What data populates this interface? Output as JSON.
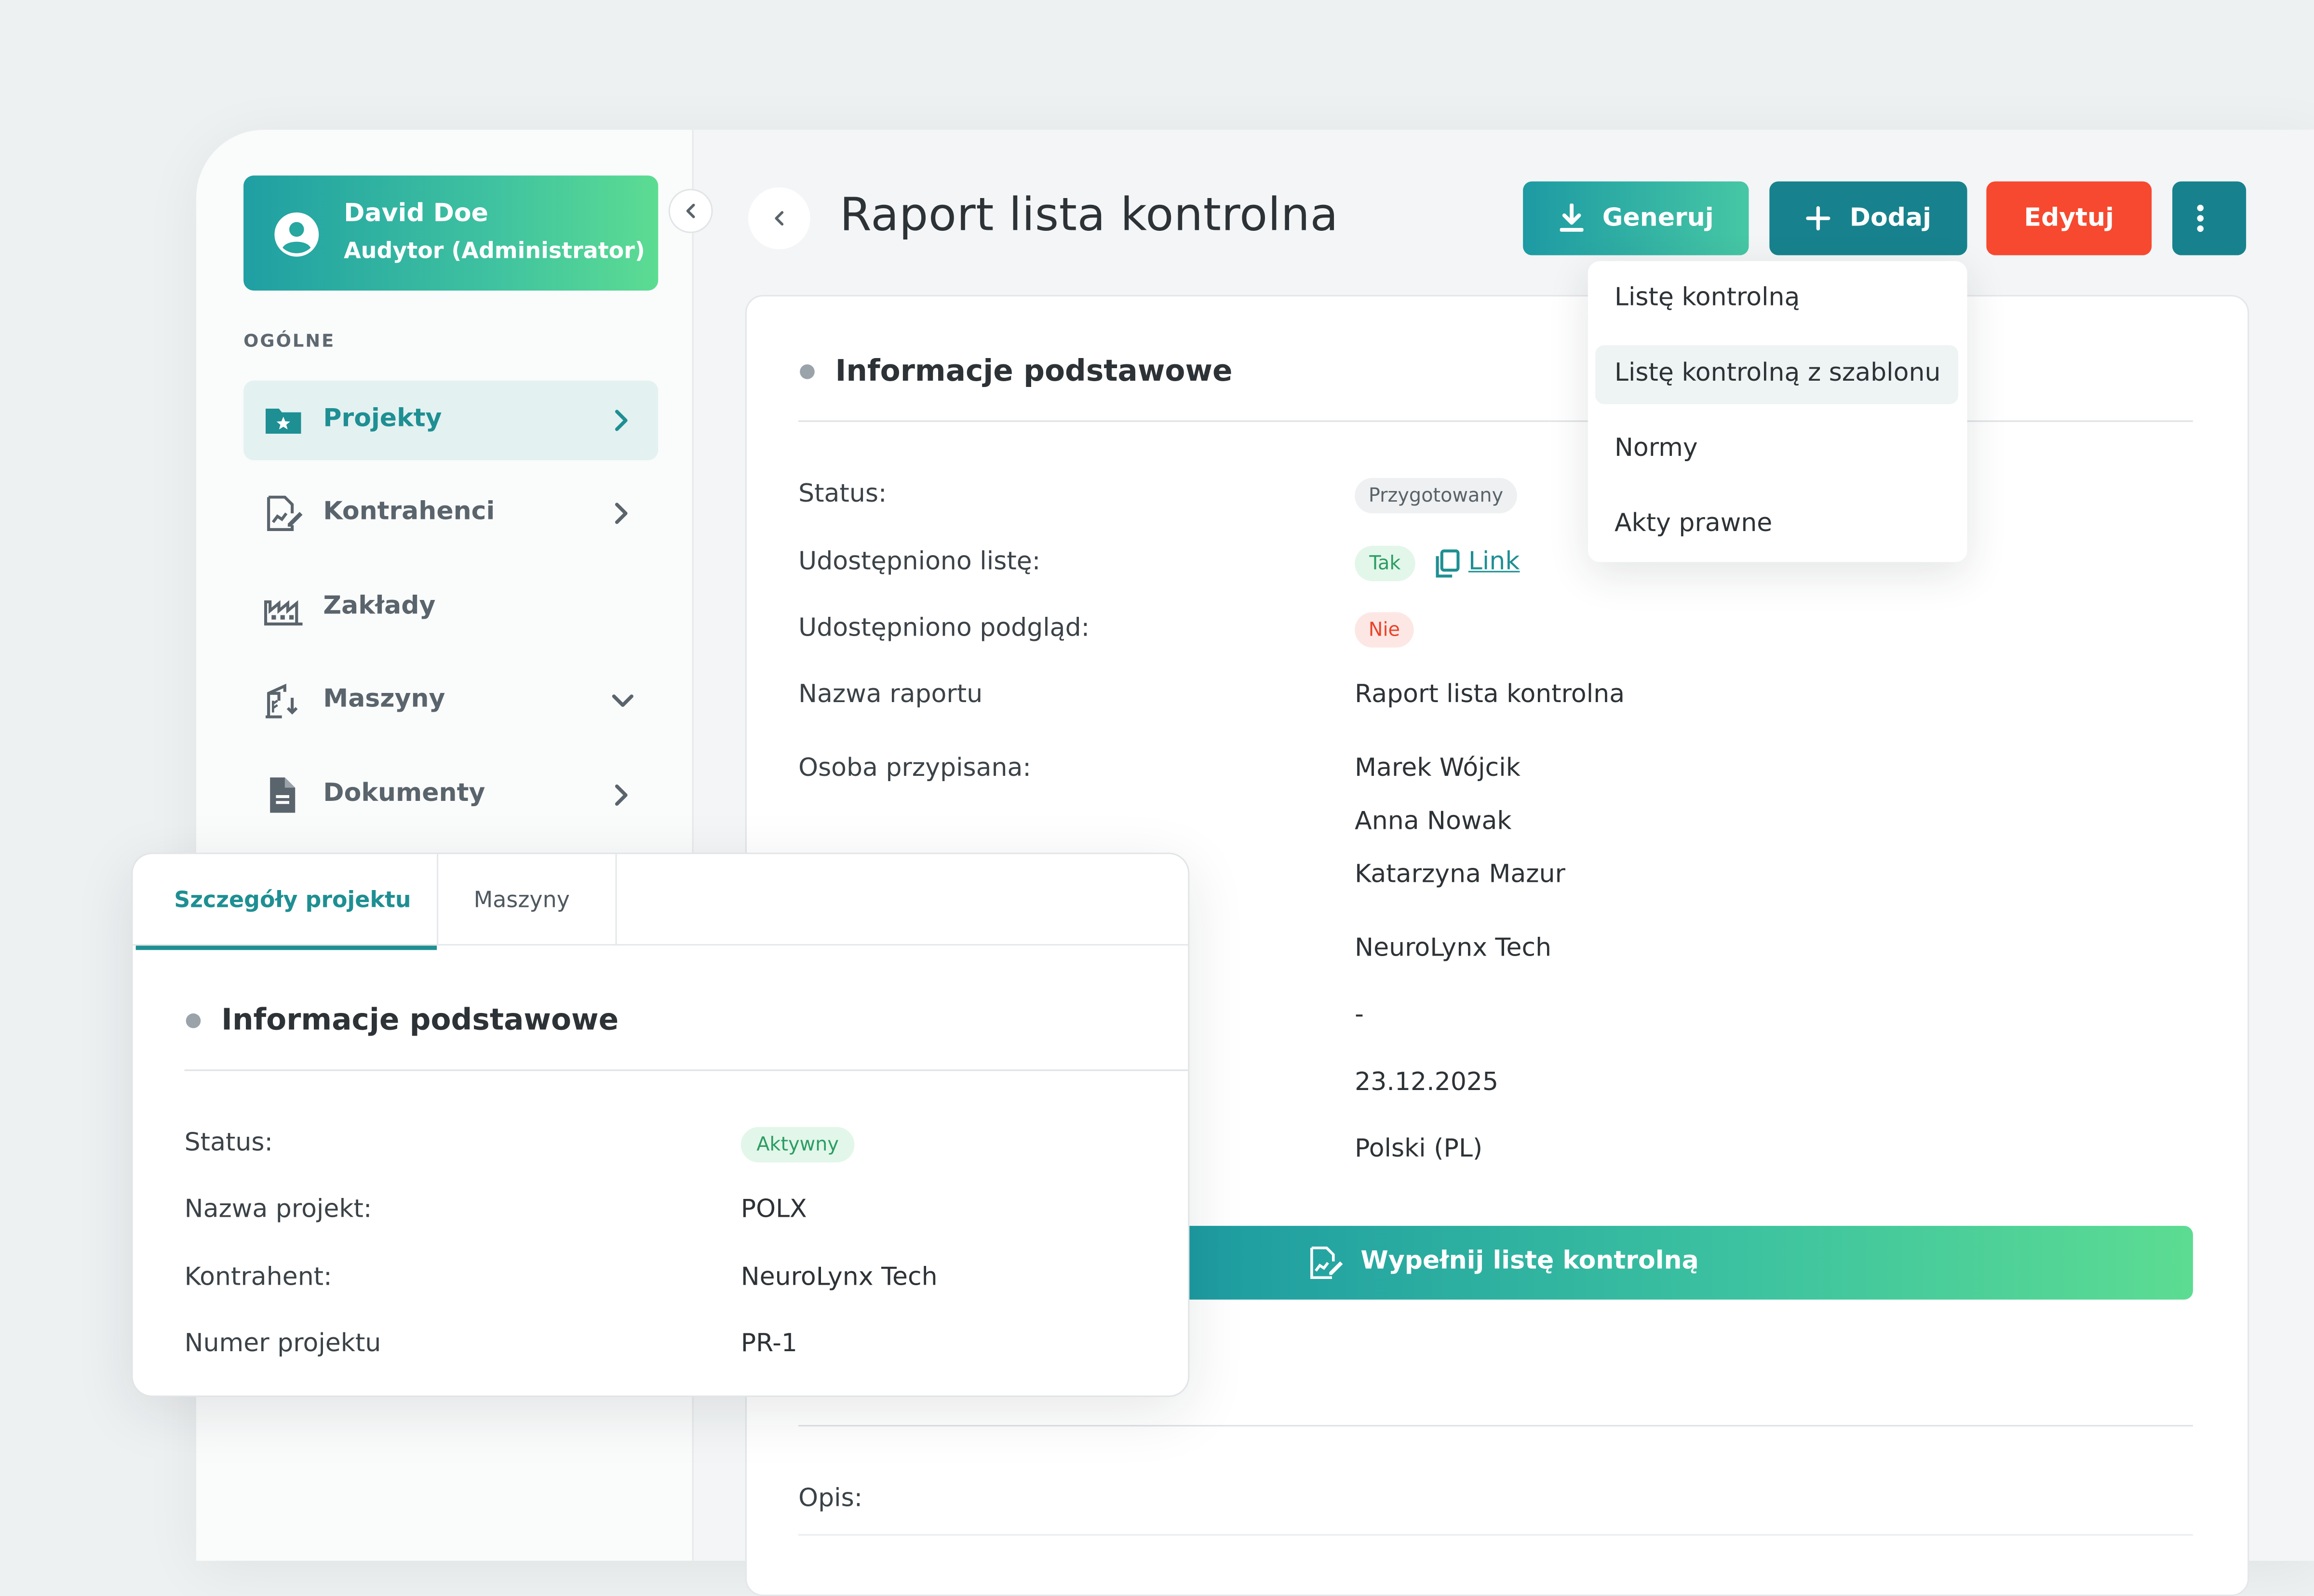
{
  "user": {
    "name": "David Doe",
    "role": "Audytor (Administrator)"
  },
  "sidebar": {
    "section_label": "OGÓLNE",
    "items": [
      {
        "label": "Projekty",
        "icon": "folder-star-icon",
        "active": true,
        "chevron": "right"
      },
      {
        "label": "Kontrahenci",
        "icon": "document-chart-icon",
        "chevron": "right"
      },
      {
        "label": "Zakłady",
        "icon": "factory-icon"
      },
      {
        "label": "Maszyny",
        "icon": "crane-icon",
        "chevron": "down"
      },
      {
        "label": "Dokumenty",
        "icon": "document-icon",
        "chevron": "right"
      }
    ]
  },
  "header": {
    "title": "Raport lista kontrolna",
    "generate_label": "Generuj",
    "add_label": "Dodaj",
    "edit_label": "Edytuj"
  },
  "add_menu": {
    "items": [
      "Listę kontrolną",
      "Listę kontrolną z szablonu",
      "Normy",
      "Akty prawne"
    ],
    "highlighted_index": 1
  },
  "report": {
    "section_title": "Informacje podstawowe",
    "labels": {
      "status": "Status:",
      "shared_list": "Udostępniono listę:",
      "shared_preview": "Udostępniono podgląd:",
      "report_name": "Nazwa raportu",
      "assigned": "Osoba przypisana:"
    },
    "status_badge": "Przygotowany",
    "shared_list_badge": "Tak",
    "link_label": "Link",
    "shared_preview_badge": "Nie",
    "report_name": "Raport lista kontrolna",
    "assigned_people": [
      "Marek Wójcik",
      "Anna Nowak",
      "Katarzyna Mazur"
    ],
    "contractor": "NeuroLynx Tech",
    "dash": "-",
    "date": "23.12.2025",
    "language": "Polski (PL)",
    "fill_button": "Wypełnij listę kontrolną",
    "description_label": "Opis:"
  },
  "project_card": {
    "tabs": [
      "Szczegóły projektu",
      "Maszyny"
    ],
    "active_tab": 0,
    "section_title": "Informacje podstawowe",
    "rows": [
      {
        "label": "Status:",
        "badge": "Aktywny"
      },
      {
        "label": "Nazwa projekt:",
        "value": "POLX"
      },
      {
        "label": "Kontrahent:",
        "value": "NeuroLynx Tech"
      },
      {
        "label": "Numer projektu",
        "value": "PR-1"
      }
    ]
  },
  "colors": {
    "teal": "#17828d",
    "teal_light": "#1e8f93",
    "green": "#5cdc92",
    "red": "#f6492f"
  }
}
